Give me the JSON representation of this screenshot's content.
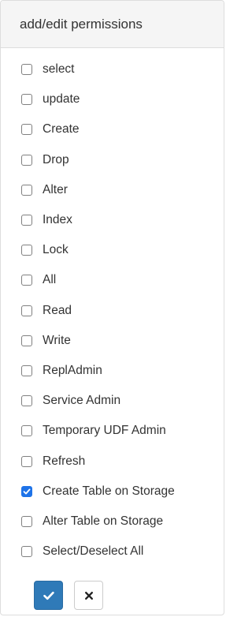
{
  "panel": {
    "title": "add/edit permissions"
  },
  "permissions": [
    {
      "label": "select",
      "checked": false
    },
    {
      "label": "update",
      "checked": false
    },
    {
      "label": "Create",
      "checked": false
    },
    {
      "label": "Drop",
      "checked": false
    },
    {
      "label": "Alter",
      "checked": false
    },
    {
      "label": "Index",
      "checked": false
    },
    {
      "label": "Lock",
      "checked": false
    },
    {
      "label": "All",
      "checked": false
    },
    {
      "label": "Read",
      "checked": false
    },
    {
      "label": "Write",
      "checked": false
    },
    {
      "label": "ReplAdmin",
      "checked": false
    },
    {
      "label": "Service Admin",
      "checked": false
    },
    {
      "label": "Temporary UDF Admin",
      "checked": false
    },
    {
      "label": "Refresh",
      "checked": false
    },
    {
      "label": "Create Table on Storage",
      "checked": true
    },
    {
      "label": "Alter Table on Storage",
      "checked": false
    },
    {
      "label": "Select/Deselect All",
      "checked": false
    }
  ],
  "actions": {
    "save_icon": "check-icon",
    "cancel_icon": "close-icon"
  },
  "colors": {
    "accent": "#1e73e8",
    "save_button": "#2f7ab8",
    "heading_bg": "#f5f5f5",
    "border": "#dddddd"
  }
}
